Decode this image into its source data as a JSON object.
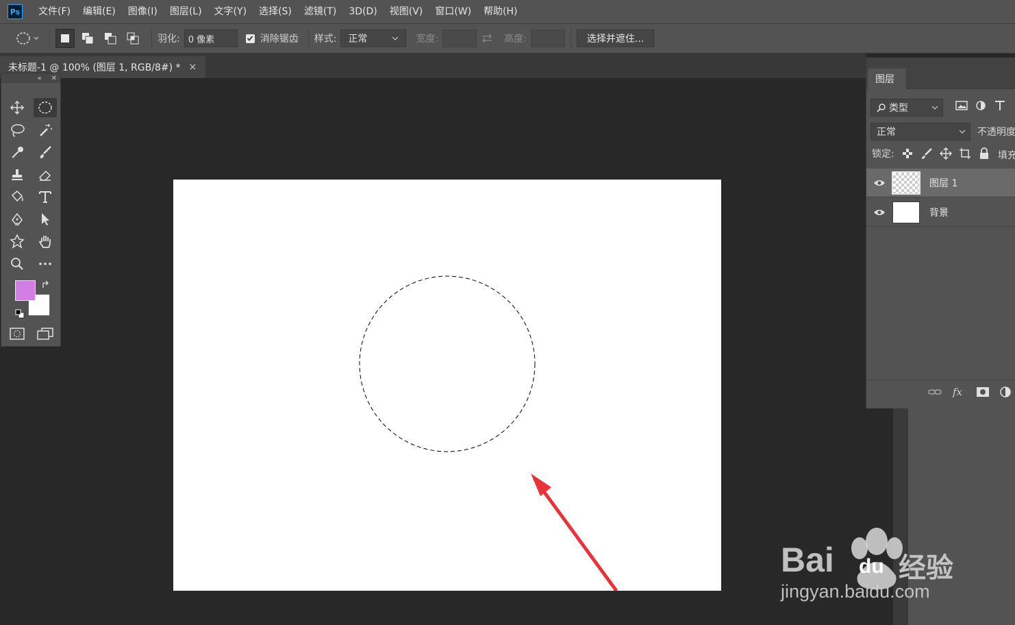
{
  "app": {
    "logo_text": "Ps"
  },
  "menu": [
    "文件(F)",
    "编辑(E)",
    "图像(I)",
    "图层(L)",
    "文字(Y)",
    "选择(S)",
    "滤镜(T)",
    "3D(D)",
    "视图(V)",
    "窗口(W)",
    "帮助(H)"
  ],
  "options": {
    "feather_label": "羽化:",
    "feather_value": "0 像素",
    "antialias_label": "消除锯齿",
    "antialias_checked": true,
    "style_label": "样式:",
    "style_value": "正常",
    "width_label": "宽度:",
    "height_label": "高度:",
    "select_mask_button": "选择并遮住..."
  },
  "document_tab": {
    "title": "未标题-1 @ 100% (图层 1, RGB/8#) *",
    "close": "×"
  },
  "colors": {
    "foreground": "#d27ee4",
    "background": "#ffffff",
    "arrow": "#e8333a"
  },
  "layers_panel": {
    "tab": "图层",
    "filter": "类型",
    "blend_mode": "正常",
    "opacity_label": "不透明度",
    "lock_label": "锁定:",
    "fill_label": "填充",
    "layers": [
      {
        "name": "图层 1",
        "selected": true,
        "thumbnail": "transparent"
      },
      {
        "name": "背景",
        "selected": false,
        "thumbnail": "white"
      }
    ]
  },
  "watermark": {
    "brand": "Bai",
    "brand2": "du",
    "cn": "经验",
    "url": "jingyan.baidu.com"
  }
}
